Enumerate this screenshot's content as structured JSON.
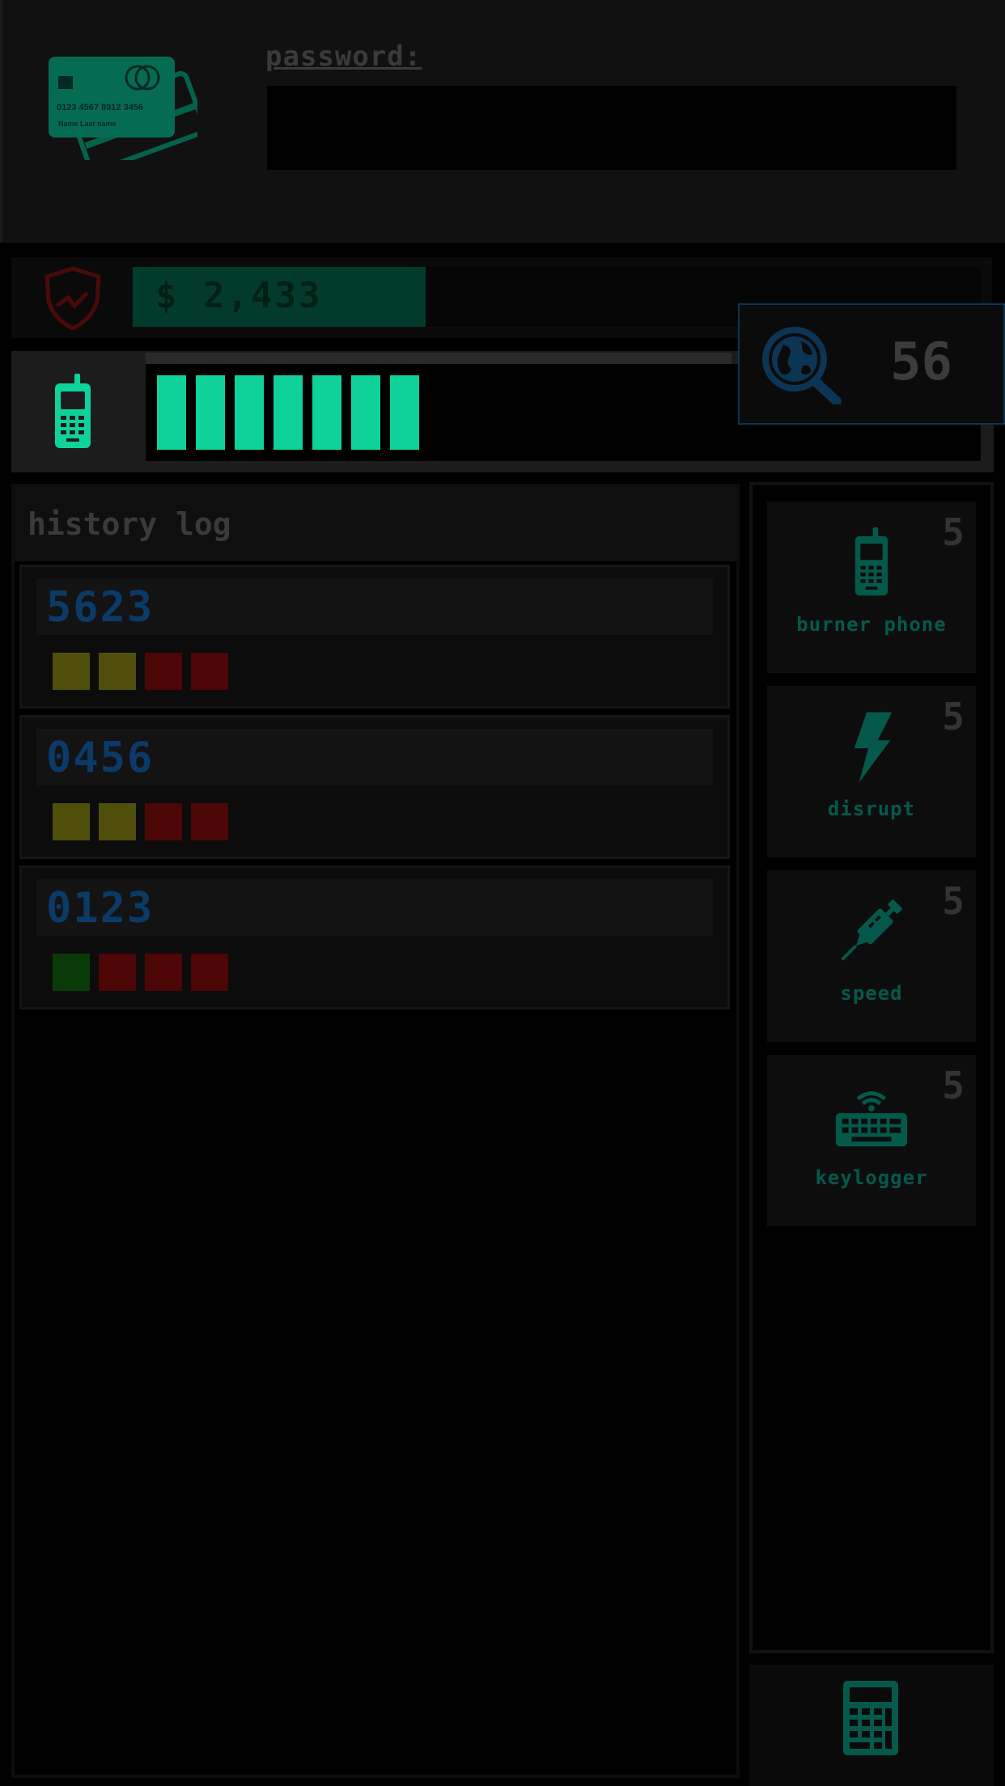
{
  "colors": {
    "accent": "#0fd29a",
    "dim_accent": "#04594a",
    "code_blue": "#0b3a66",
    "yellow": "#4f4f0b",
    "red": "#4b0605",
    "green": "#0a3a08"
  },
  "login": {
    "password_label": "password:",
    "password_value": "",
    "card_icon": "credit-card-icon",
    "card_number": "0123 4567 8912 3456",
    "card_name": "Name  Last name"
  },
  "status": {
    "money": "$ 2,433",
    "money_fill_fraction": 0.345,
    "shield_icon": "shield-icon",
    "phone_icon": "cell-phone-icon",
    "signal_segments": 7,
    "trace_icon": "globe-search-icon",
    "trace_value": "56"
  },
  "history": {
    "title": "history log",
    "entries": [
      {
        "code": "5623",
        "marks": [
          "y",
          "y",
          "r",
          "r"
        ]
      },
      {
        "code": "0456",
        "marks": [
          "y",
          "y",
          "r",
          "r"
        ]
      },
      {
        "code": "0123",
        "marks": [
          "g",
          "r",
          "r",
          "r"
        ]
      }
    ]
  },
  "tools": [
    {
      "label": "burner phone",
      "count": "5",
      "icon": "cell-phone-icon"
    },
    {
      "label": "disrupt",
      "count": "5",
      "icon": "lightning-icon"
    },
    {
      "label": "speed",
      "count": "5",
      "icon": "syringe-icon"
    },
    {
      "label": "keylogger",
      "count": "5",
      "icon": "keyboard-wifi-icon"
    }
  ],
  "footer": {
    "calculator_icon": "calculator-icon"
  }
}
